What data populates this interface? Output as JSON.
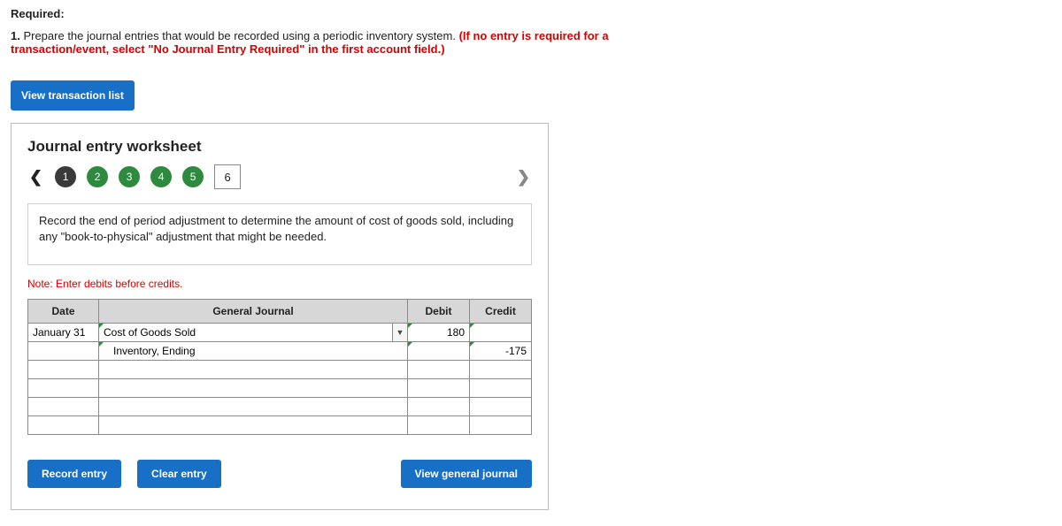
{
  "required_label": "Required:",
  "question": {
    "num": "1.",
    "text_a": " Prepare the journal entries that would be recorded using a periodic inventory system. ",
    "text_b": "(If no entry is required for a transaction/event, select \"No Journal Entry Required\" in the first account field.)"
  },
  "view_transaction_list": "View transaction list",
  "worksheet": {
    "title": "Journal entry worksheet",
    "steps": [
      "1",
      "2",
      "3",
      "4",
      "5",
      "6"
    ],
    "instruction": "Record the end of period adjustment to determine the amount of cost of goods sold, including any \"book-to-physical\" adjustment that might be needed.",
    "note": "Note: Enter debits before credits.",
    "headers": {
      "date": "Date",
      "journal": "General Journal",
      "debit": "Debit",
      "credit": "Credit"
    },
    "rows": [
      {
        "date": "January 31",
        "account": "Cost of Goods Sold",
        "dd": true,
        "debit": "180",
        "credit": ""
      },
      {
        "date": "",
        "account": "Inventory, Ending",
        "dd": false,
        "debit": "",
        "credit": "-175"
      },
      {
        "date": "",
        "account": "",
        "dd": false,
        "debit": "",
        "credit": ""
      },
      {
        "date": "",
        "account": "",
        "dd": false,
        "debit": "",
        "credit": ""
      },
      {
        "date": "",
        "account": "",
        "dd": false,
        "debit": "",
        "credit": ""
      },
      {
        "date": "",
        "account": "",
        "dd": false,
        "debit": "",
        "credit": ""
      }
    ],
    "buttons": {
      "record": "Record entry",
      "clear": "Clear entry",
      "view": "View general journal"
    }
  }
}
